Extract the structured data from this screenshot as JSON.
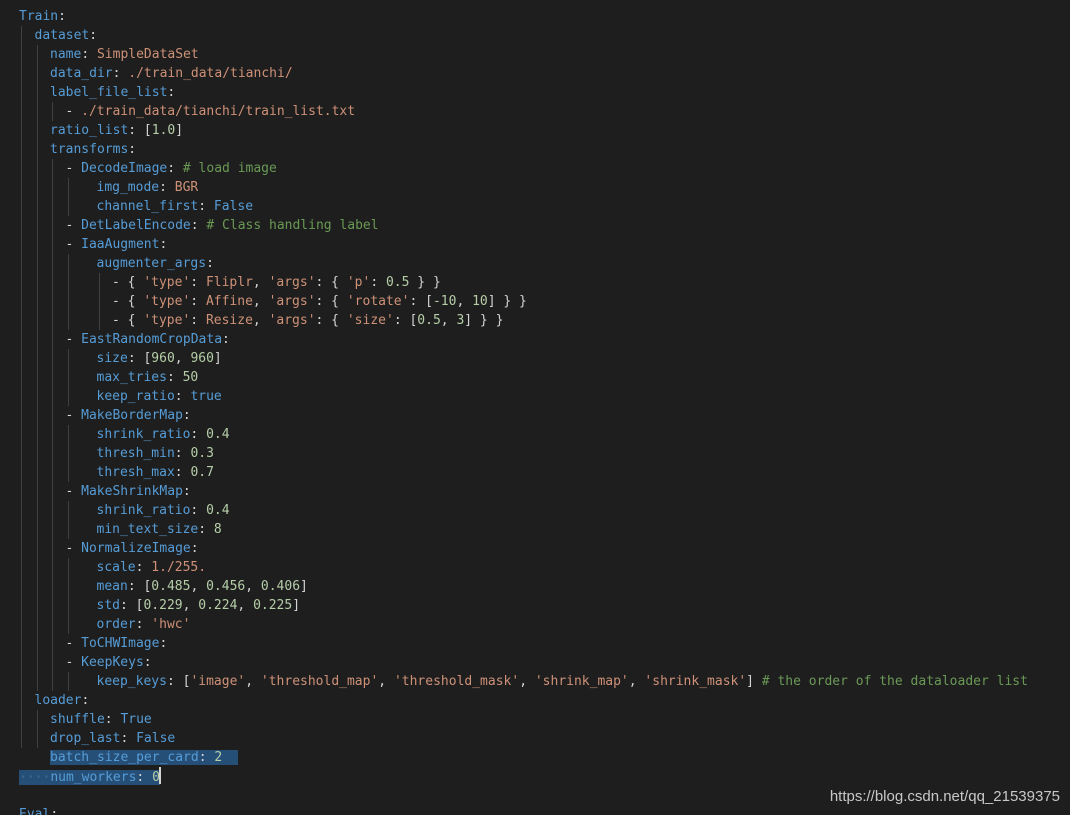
{
  "editor": {
    "lines": [
      {
        "indent": 0,
        "tokens": [
          [
            "k",
            "Train"
          ],
          [
            "p",
            ":"
          ]
        ]
      },
      {
        "indent": 1,
        "tokens": [
          [
            "k",
            "dataset"
          ],
          [
            "p",
            ":"
          ]
        ]
      },
      {
        "indent": 2,
        "tokens": [
          [
            "k",
            "name"
          ],
          [
            "p",
            ": "
          ],
          [
            "s",
            "SimpleDataSet"
          ]
        ]
      },
      {
        "indent": 2,
        "tokens": [
          [
            "k",
            "data_dir"
          ],
          [
            "p",
            ": "
          ],
          [
            "s",
            "./train_data/tianchi/"
          ]
        ]
      },
      {
        "indent": 2,
        "tokens": [
          [
            "k",
            "label_file_list"
          ],
          [
            "p",
            ":"
          ]
        ]
      },
      {
        "indent": 3,
        "tokens": [
          [
            "p",
            "- "
          ],
          [
            "s",
            "./train_data/tianchi/train_list.txt"
          ]
        ]
      },
      {
        "indent": 2,
        "tokens": [
          [
            "k",
            "ratio_list"
          ],
          [
            "p",
            ": ["
          ],
          [
            "n",
            "1.0"
          ],
          [
            "p",
            "]"
          ]
        ]
      },
      {
        "indent": 2,
        "tokens": [
          [
            "k",
            "transforms"
          ],
          [
            "p",
            ":"
          ]
        ]
      },
      {
        "indent": 3,
        "tokens": [
          [
            "p",
            "- "
          ],
          [
            "k",
            "DecodeImage"
          ],
          [
            "p",
            ": "
          ],
          [
            "c",
            "# load image"
          ]
        ]
      },
      {
        "indent": 5,
        "tokens": [
          [
            "k",
            "img_mode"
          ],
          [
            "p",
            ": "
          ],
          [
            "s",
            "BGR"
          ]
        ]
      },
      {
        "indent": 5,
        "tokens": [
          [
            "k",
            "channel_first"
          ],
          [
            "p",
            ": "
          ],
          [
            "k",
            "False"
          ]
        ]
      },
      {
        "indent": 3,
        "tokens": [
          [
            "p",
            "- "
          ],
          [
            "k",
            "DetLabelEncode"
          ],
          [
            "p",
            ": "
          ],
          [
            "c",
            "# Class handling label"
          ]
        ]
      },
      {
        "indent": 3,
        "tokens": [
          [
            "p",
            "- "
          ],
          [
            "k",
            "IaaAugment"
          ],
          [
            "p",
            ":"
          ]
        ]
      },
      {
        "indent": 5,
        "tokens": [
          [
            "k",
            "augmenter_args"
          ],
          [
            "p",
            ":"
          ]
        ]
      },
      {
        "indent": 6,
        "tokens": [
          [
            "p",
            "- { "
          ],
          [
            "s",
            "'type'"
          ],
          [
            "p",
            ": "
          ],
          [
            "s",
            "Fliplr"
          ],
          [
            "p",
            ", "
          ],
          [
            "s",
            "'args'"
          ],
          [
            "p",
            ": { "
          ],
          [
            "s",
            "'p'"
          ],
          [
            "p",
            ": "
          ],
          [
            "n",
            "0.5"
          ],
          [
            "p",
            " } }"
          ]
        ]
      },
      {
        "indent": 6,
        "tokens": [
          [
            "p",
            "- { "
          ],
          [
            "s",
            "'type'"
          ],
          [
            "p",
            ": "
          ],
          [
            "s",
            "Affine"
          ],
          [
            "p",
            ", "
          ],
          [
            "s",
            "'args'"
          ],
          [
            "p",
            ": { "
          ],
          [
            "s",
            "'rotate'"
          ],
          [
            "p",
            ": ["
          ],
          [
            "n",
            "-10"
          ],
          [
            "p",
            ", "
          ],
          [
            "n",
            "10"
          ],
          [
            "p",
            "] } }"
          ]
        ]
      },
      {
        "indent": 6,
        "tokens": [
          [
            "p",
            "- { "
          ],
          [
            "s",
            "'type'"
          ],
          [
            "p",
            ": "
          ],
          [
            "s",
            "Resize"
          ],
          [
            "p",
            ", "
          ],
          [
            "s",
            "'args'"
          ],
          [
            "p",
            ": { "
          ],
          [
            "s",
            "'size'"
          ],
          [
            "p",
            ": ["
          ],
          [
            "n",
            "0.5"
          ],
          [
            "p",
            ", "
          ],
          [
            "n",
            "3"
          ],
          [
            "p",
            "] } }"
          ]
        ]
      },
      {
        "indent": 3,
        "tokens": [
          [
            "p",
            "- "
          ],
          [
            "k",
            "EastRandomCropData"
          ],
          [
            "p",
            ":"
          ]
        ]
      },
      {
        "indent": 5,
        "tokens": [
          [
            "k",
            "size"
          ],
          [
            "p",
            ": ["
          ],
          [
            "n",
            "960"
          ],
          [
            "p",
            ", "
          ],
          [
            "n",
            "960"
          ],
          [
            "p",
            "]"
          ]
        ]
      },
      {
        "indent": 5,
        "tokens": [
          [
            "k",
            "max_tries"
          ],
          [
            "p",
            ": "
          ],
          [
            "n",
            "50"
          ]
        ]
      },
      {
        "indent": 5,
        "tokens": [
          [
            "k",
            "keep_ratio"
          ],
          [
            "p",
            ": "
          ],
          [
            "k",
            "true"
          ]
        ]
      },
      {
        "indent": 3,
        "tokens": [
          [
            "p",
            "- "
          ],
          [
            "k",
            "MakeBorderMap"
          ],
          [
            "p",
            ":"
          ]
        ]
      },
      {
        "indent": 5,
        "tokens": [
          [
            "k",
            "shrink_ratio"
          ],
          [
            "p",
            ": "
          ],
          [
            "n",
            "0.4"
          ]
        ]
      },
      {
        "indent": 5,
        "tokens": [
          [
            "k",
            "thresh_min"
          ],
          [
            "p",
            ": "
          ],
          [
            "n",
            "0.3"
          ]
        ]
      },
      {
        "indent": 5,
        "tokens": [
          [
            "k",
            "thresh_max"
          ],
          [
            "p",
            ": "
          ],
          [
            "n",
            "0.7"
          ]
        ]
      },
      {
        "indent": 3,
        "tokens": [
          [
            "p",
            "- "
          ],
          [
            "k",
            "MakeShrinkMap"
          ],
          [
            "p",
            ":"
          ]
        ]
      },
      {
        "indent": 5,
        "tokens": [
          [
            "k",
            "shrink_ratio"
          ],
          [
            "p",
            ": "
          ],
          [
            "n",
            "0.4"
          ]
        ]
      },
      {
        "indent": 5,
        "tokens": [
          [
            "k",
            "min_text_size"
          ],
          [
            "p",
            ": "
          ],
          [
            "n",
            "8"
          ]
        ]
      },
      {
        "indent": 3,
        "tokens": [
          [
            "p",
            "- "
          ],
          [
            "k",
            "NormalizeImage"
          ],
          [
            "p",
            ":"
          ]
        ]
      },
      {
        "indent": 5,
        "tokens": [
          [
            "k",
            "scale"
          ],
          [
            "p",
            ": "
          ],
          [
            "s",
            "1./255."
          ]
        ]
      },
      {
        "indent": 5,
        "tokens": [
          [
            "k",
            "mean"
          ],
          [
            "p",
            ": ["
          ],
          [
            "n",
            "0.485"
          ],
          [
            "p",
            ", "
          ],
          [
            "n",
            "0.456"
          ],
          [
            "p",
            ", "
          ],
          [
            "n",
            "0.406"
          ],
          [
            "p",
            "]"
          ]
        ]
      },
      {
        "indent": 5,
        "tokens": [
          [
            "k",
            "std"
          ],
          [
            "p",
            ": ["
          ],
          [
            "n",
            "0.229"
          ],
          [
            "p",
            ", "
          ],
          [
            "n",
            "0.224"
          ],
          [
            "p",
            ", "
          ],
          [
            "n",
            "0.225"
          ],
          [
            "p",
            "]"
          ]
        ]
      },
      {
        "indent": 5,
        "tokens": [
          [
            "k",
            "order"
          ],
          [
            "p",
            ": "
          ],
          [
            "s",
            "'hwc'"
          ]
        ]
      },
      {
        "indent": 3,
        "tokens": [
          [
            "p",
            "- "
          ],
          [
            "k",
            "ToCHWImage"
          ],
          [
            "p",
            ":"
          ]
        ]
      },
      {
        "indent": 3,
        "tokens": [
          [
            "p",
            "- "
          ],
          [
            "k",
            "KeepKeys"
          ],
          [
            "p",
            ":"
          ]
        ]
      },
      {
        "indent": 5,
        "tokens": [
          [
            "k",
            "keep_keys"
          ],
          [
            "p",
            ": ["
          ],
          [
            "s",
            "'image'"
          ],
          [
            "p",
            ", "
          ],
          [
            "s",
            "'threshold_map'"
          ],
          [
            "p",
            ", "
          ],
          [
            "s",
            "'threshold_mask'"
          ],
          [
            "p",
            ", "
          ],
          [
            "s",
            "'shrink_map'"
          ],
          [
            "p",
            ", "
          ],
          [
            "s",
            "'shrink_mask'"
          ],
          [
            "p",
            "] "
          ],
          [
            "c",
            "# the order of the dataloader list"
          ]
        ]
      },
      {
        "indent": 1,
        "tokens": [
          [
            "k",
            "loader"
          ],
          [
            "p",
            ":"
          ]
        ]
      },
      {
        "indent": 2,
        "tokens": [
          [
            "k",
            "shuffle"
          ],
          [
            "p",
            ": "
          ],
          [
            "k",
            "True"
          ]
        ]
      },
      {
        "indent": 2,
        "tokens": [
          [
            "k",
            "drop_last"
          ],
          [
            "p",
            ": "
          ],
          [
            "k",
            "False"
          ]
        ]
      },
      {
        "indent": 2,
        "selected": true,
        "tokens": [
          [
            "k",
            "batch_size_per_card"
          ],
          [
            "p",
            ": "
          ],
          [
            "n",
            "2"
          ]
        ]
      },
      {
        "indent": 0,
        "selected": true,
        "cursor": true,
        "tokens": [
          [
            "ws",
            "····"
          ],
          [
            "k",
            "num_workers"
          ],
          [
            "p",
            ": "
          ],
          [
            "n",
            "0"
          ]
        ]
      },
      {
        "indent": 0,
        "tokens": []
      },
      {
        "indent": 0,
        "tokens": [
          [
            "k",
            "Eval"
          ],
          [
            "p",
            ":"
          ]
        ]
      }
    ]
  },
  "watermark": "https://blog.csdn.net/qq_21539375"
}
